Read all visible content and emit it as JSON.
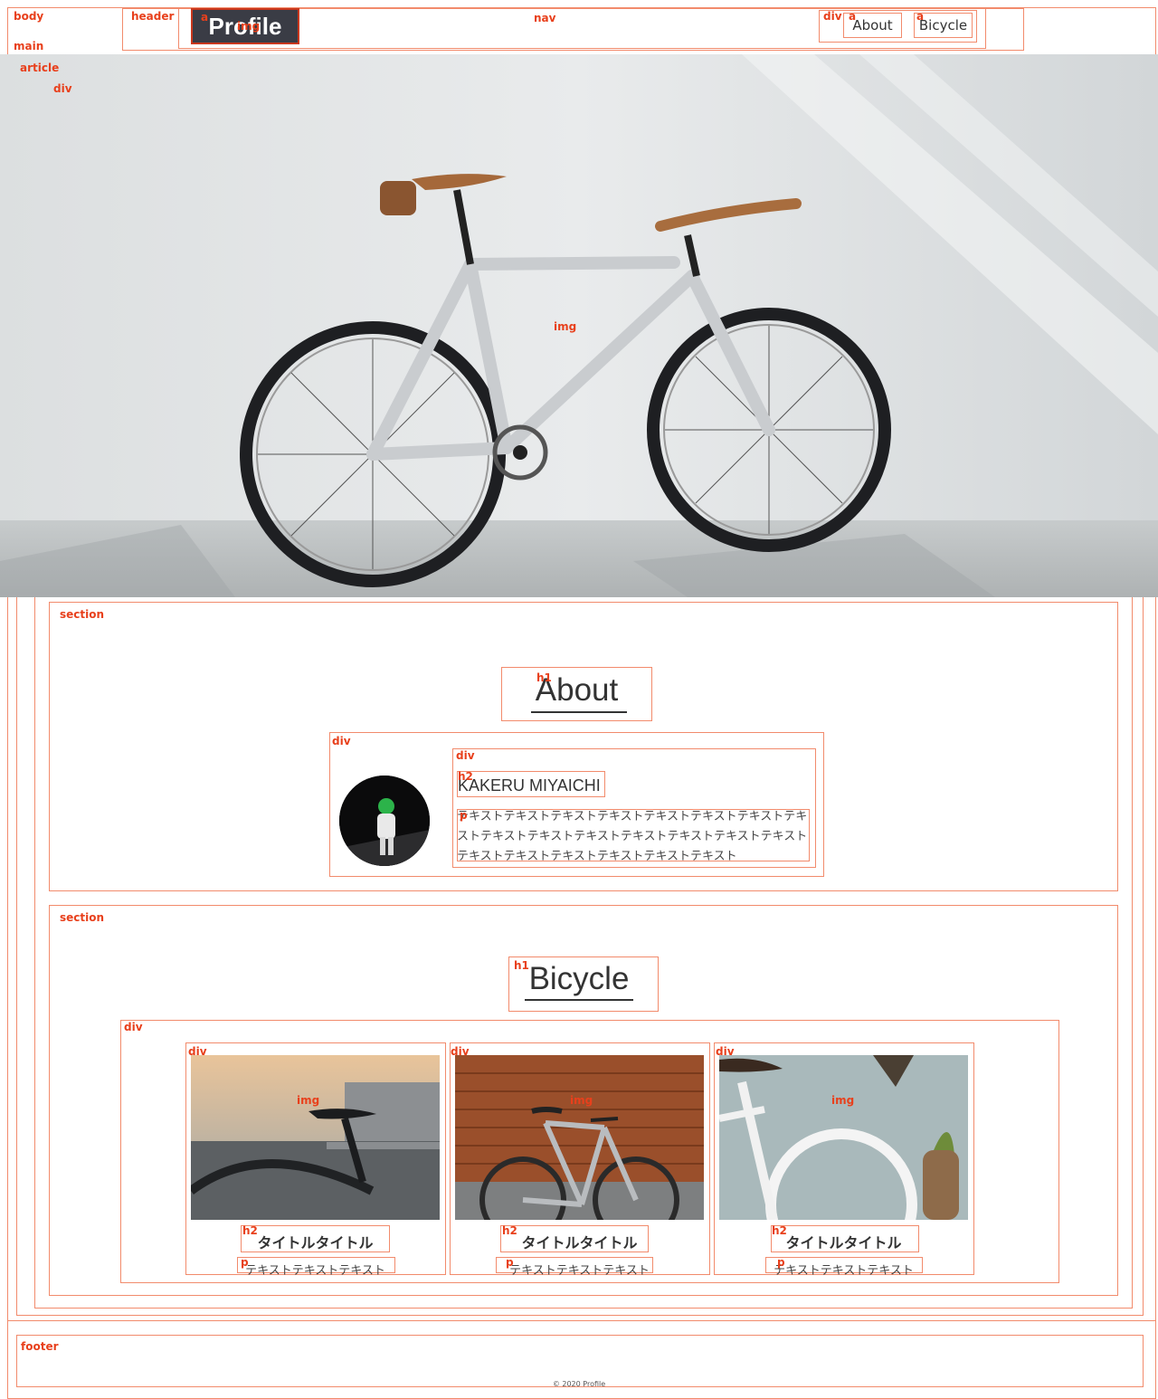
{
  "header": {
    "logo": "Profile",
    "nav": [
      {
        "label": "About"
      },
      {
        "label": "Bicycle"
      }
    ]
  },
  "hero": {
    "image": "bicycle-photo"
  },
  "about": {
    "heading": "About",
    "name": "KAKERU MIYAICHI",
    "text": "テキストテキストテキストテキストテキストテキストテキストテキストテキストテキストテキストテキストテキストテキストテキストテキストテキストテキストテキストテキストテキスト"
  },
  "bicycle": {
    "heading": "Bicycle",
    "cards": [
      {
        "title": "タイトルタイトル",
        "text": "テキストテキストテキスト"
      },
      {
        "title": "タイトルタイトル",
        "text": "テキストテキストテキスト"
      },
      {
        "title": "タイトルタイトル",
        "text": "テキストテキストテキスト"
      }
    ]
  },
  "footer": {
    "copyright": "© 2020 Profile"
  },
  "outline_labels": {
    "body": "body",
    "header": "header",
    "nav": "nav",
    "main": "main",
    "article": "article",
    "div": "div",
    "a": "a",
    "img": "img",
    "section": "section",
    "h1": "h1",
    "h2": "h2",
    "p": "p",
    "footer": "footer"
  },
  "colors": {
    "outline": "#f28b6c",
    "outline_label": "#e8401c",
    "logo_bg": "#3a3c45",
    "text": "#333333"
  }
}
